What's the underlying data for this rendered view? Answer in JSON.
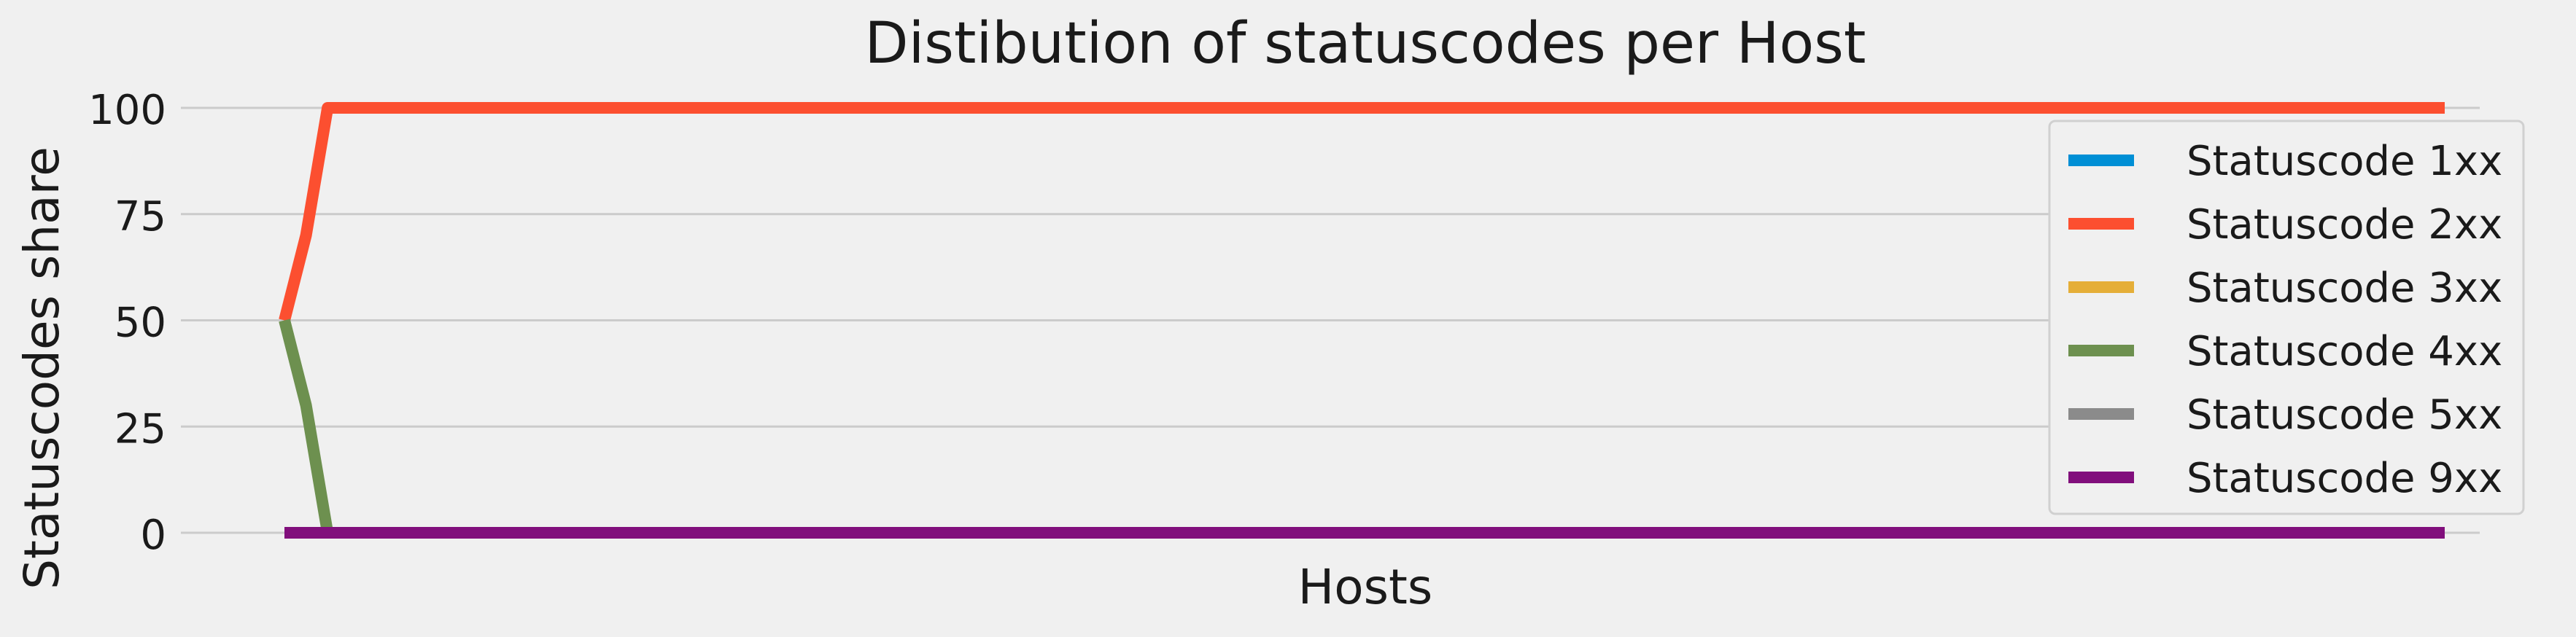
{
  "chart_data": {
    "type": "line",
    "title": "Distibution of statuscodes per Host",
    "xlabel": "Hosts",
    "ylabel": "Statuscodes share",
    "ylim": [
      0,
      100
    ],
    "y_ticks": [
      "0",
      "25",
      "50",
      "75",
      "100"
    ],
    "y_tick_values": [
      0,
      25,
      50,
      75,
      100
    ],
    "grid": true,
    "legend_position": "right",
    "x": [
      0,
      1,
      2,
      3,
      4,
      5,
      6,
      7,
      8,
      9,
      10,
      11,
      12,
      13,
      14,
      15,
      16,
      17,
      18,
      19,
      20,
      21,
      22,
      23,
      24,
      25,
      26,
      27,
      28,
      29,
      30,
      31,
      32,
      33,
      34,
      35,
      36,
      37,
      38,
      39,
      40,
      41,
      42,
      43,
      44,
      45,
      46,
      47,
      48,
      49,
      50,
      51,
      52,
      53,
      54,
      55,
      56,
      57,
      58,
      59,
      60,
      61,
      62,
      63,
      64,
      65,
      66,
      67,
      68,
      69,
      70,
      71,
      72,
      73,
      74,
      75,
      76,
      77,
      78,
      79,
      80,
      81,
      82,
      83,
      84,
      85,
      86,
      87,
      88,
      89,
      90,
      91,
      92,
      93,
      94,
      95,
      96,
      97,
      98,
      99,
      100
    ],
    "series": [
      {
        "name": "Statuscode 1xx",
        "color": "#008fd5",
        "values": [
          0,
          0,
          0,
          0,
          0,
          0,
          0,
          0,
          0,
          0,
          0,
          0,
          0,
          0,
          0,
          0,
          0,
          0,
          0,
          0,
          0,
          0,
          0,
          0,
          0,
          0,
          0,
          0,
          0,
          0,
          0,
          0,
          0,
          0,
          0,
          0,
          0,
          0,
          0,
          0,
          0,
          0,
          0,
          0,
          0,
          0,
          0,
          0,
          0,
          0,
          0,
          0,
          0,
          0,
          0,
          0,
          0,
          0,
          0,
          0,
          0,
          0,
          0,
          0,
          0,
          0,
          0,
          0,
          0,
          0,
          0,
          0,
          0,
          0,
          0,
          0,
          0,
          0,
          0,
          0,
          0,
          0,
          0,
          0,
          0,
          0,
          0,
          0,
          0,
          0,
          0,
          0,
          0,
          0,
          0,
          0,
          0,
          0,
          0,
          0,
          0
        ]
      },
      {
        "name": "Statuscode 2xx",
        "color": "#fc4f30",
        "values": [
          50,
          70,
          100,
          100,
          100,
          100,
          100,
          100,
          100,
          100,
          100,
          100,
          100,
          100,
          100,
          100,
          100,
          100,
          100,
          100,
          100,
          100,
          100,
          100,
          100,
          100,
          100,
          100,
          100,
          100,
          100,
          100,
          100,
          100,
          100,
          100,
          100,
          100,
          100,
          100,
          100,
          100,
          100,
          100,
          100,
          100,
          100,
          100,
          100,
          100,
          100,
          100,
          100,
          100,
          100,
          100,
          100,
          100,
          100,
          100,
          100,
          100,
          100,
          100,
          100,
          100,
          100,
          100,
          100,
          100,
          100,
          100,
          100,
          100,
          100,
          100,
          100,
          100,
          100,
          100,
          100,
          100,
          100,
          100,
          100,
          100,
          100,
          100,
          100,
          100,
          100,
          100,
          100,
          100,
          100,
          100,
          100,
          100,
          100,
          100,
          100
        ]
      },
      {
        "name": "Statuscode 3xx",
        "color": "#e5ae38",
        "values": [
          0,
          0,
          0,
          0,
          0,
          0,
          0,
          0,
          0,
          0,
          0,
          0,
          0,
          0,
          0,
          0,
          0,
          0,
          0,
          0,
          0,
          0,
          0,
          0,
          0,
          0,
          0,
          0,
          0,
          0,
          0,
          0,
          0,
          0,
          0,
          0,
          0,
          0,
          0,
          0,
          0,
          0,
          0,
          0,
          0,
          0,
          0,
          0,
          0,
          0,
          0,
          0,
          0,
          0,
          0,
          0,
          0,
          0,
          0,
          0,
          0,
          0,
          0,
          0,
          0,
          0,
          0,
          0,
          0,
          0,
          0,
          0,
          0,
          0,
          0,
          0,
          0,
          0,
          0,
          0,
          0,
          0,
          0,
          0,
          0,
          0,
          0,
          0,
          0,
          0,
          0,
          0,
          0,
          0,
          0,
          0,
          0,
          0,
          0,
          0,
          0
        ]
      },
      {
        "name": "Statuscode 4xx",
        "color": "#6d904f",
        "values": [
          50,
          30,
          0,
          0,
          0,
          0,
          0,
          0,
          0,
          0,
          0,
          0,
          0,
          0,
          0,
          0,
          0,
          0,
          0,
          0,
          0,
          0,
          0,
          0,
          0,
          0,
          0,
          0,
          0,
          0,
          0,
          0,
          0,
          0,
          0,
          0,
          0,
          0,
          0,
          0,
          0,
          0,
          0,
          0,
          0,
          0,
          0,
          0,
          0,
          0,
          0,
          0,
          0,
          0,
          0,
          0,
          0,
          0,
          0,
          0,
          0,
          0,
          0,
          0,
          0,
          0,
          0,
          0,
          0,
          0,
          0,
          0,
          0,
          0,
          0,
          0,
          0,
          0,
          0,
          0,
          0,
          0,
          0,
          0,
          0,
          0,
          0,
          0,
          0,
          0,
          0,
          0,
          0,
          0,
          0,
          0,
          0,
          0,
          0,
          0,
          0
        ]
      },
      {
        "name": "Statuscode 5xx",
        "color": "#8b8b8b",
        "values": [
          0,
          0,
          0,
          0,
          0,
          0,
          0,
          0,
          0,
          0,
          0,
          0,
          0,
          0,
          0,
          0,
          0,
          0,
          0,
          0,
          0,
          0,
          0,
          0,
          0,
          0,
          0,
          0,
          0,
          0,
          0,
          0,
          0,
          0,
          0,
          0,
          0,
          0,
          0,
          0,
          0,
          0,
          0,
          0,
          0,
          0,
          0,
          0,
          0,
          0,
          0,
          0,
          0,
          0,
          0,
          0,
          0,
          0,
          0,
          0,
          0,
          0,
          0,
          0,
          0,
          0,
          0,
          0,
          0,
          0,
          0,
          0,
          0,
          0,
          0,
          0,
          0,
          0,
          0,
          0,
          0,
          0,
          0,
          0,
          0,
          0,
          0,
          0,
          0,
          0,
          0,
          0,
          0,
          0,
          0,
          0,
          0,
          0,
          0,
          0,
          0
        ]
      },
      {
        "name": "Statuscode 9xx",
        "color": "#810f7c",
        "values": [
          0,
          0,
          0,
          0,
          0,
          0,
          0,
          0,
          0,
          0,
          0,
          0,
          0,
          0,
          0,
          0,
          0,
          0,
          0,
          0,
          0,
          0,
          0,
          0,
          0,
          0,
          0,
          0,
          0,
          0,
          0,
          0,
          0,
          0,
          0,
          0,
          0,
          0,
          0,
          0,
          0,
          0,
          0,
          0,
          0,
          0,
          0,
          0,
          0,
          0,
          0,
          0,
          0,
          0,
          0,
          0,
          0,
          0,
          0,
          0,
          0,
          0,
          0,
          0,
          0,
          0,
          0,
          0,
          0,
          0,
          0,
          0,
          0,
          0,
          0,
          0,
          0,
          0,
          0,
          0,
          0,
          0,
          0,
          0,
          0,
          0,
          0,
          0,
          0,
          0,
          0,
          0,
          0,
          0,
          0,
          0,
          0,
          0,
          0,
          0,
          0
        ]
      }
    ]
  }
}
